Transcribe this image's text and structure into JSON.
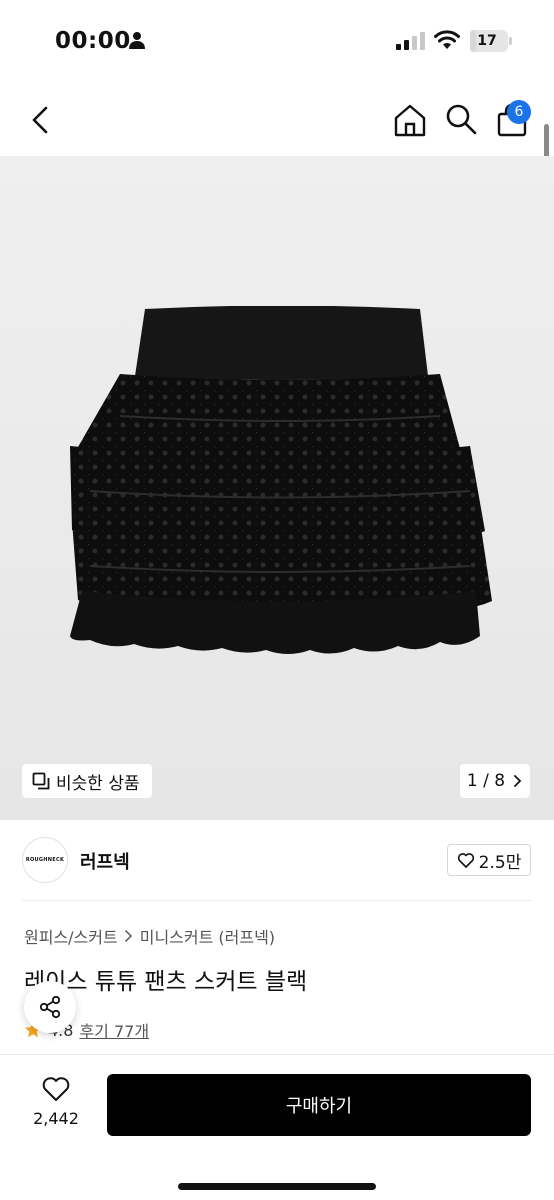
{
  "status_bar": {
    "time": "00:00",
    "battery": "17",
    "battery_level": 0.17,
    "icons": [
      "person-icon",
      "signal-icon",
      "wifi-icon",
      "battery-icon"
    ]
  },
  "nav": {
    "icons": [
      "chevron-left-icon",
      "home-icon",
      "search-icon",
      "shopping-bag-icon"
    ],
    "cart_badge": "6"
  },
  "image": {
    "similar_label": "비슷한 상품",
    "counter": "1 / 8",
    "description": "black tiered lace mini skirt"
  },
  "brand": {
    "logo_text": "ROUGHNECK",
    "name": "러프넥",
    "likes": "2.5만"
  },
  "product": {
    "breadcrumb": [
      "원피스/스커트",
      "미니스커트 (러프넥)"
    ],
    "title": "레이스 튜튜 팬츠 스커트 블랙",
    "rating": "4.8",
    "reviews": "후기 77개"
  },
  "bottom_bar": {
    "wish_count": "2,442",
    "buy_label": "구매하기"
  },
  "colors": {
    "accent_badge": "#1a73e8",
    "star": "#f5a623",
    "buy_button": "#000000"
  }
}
